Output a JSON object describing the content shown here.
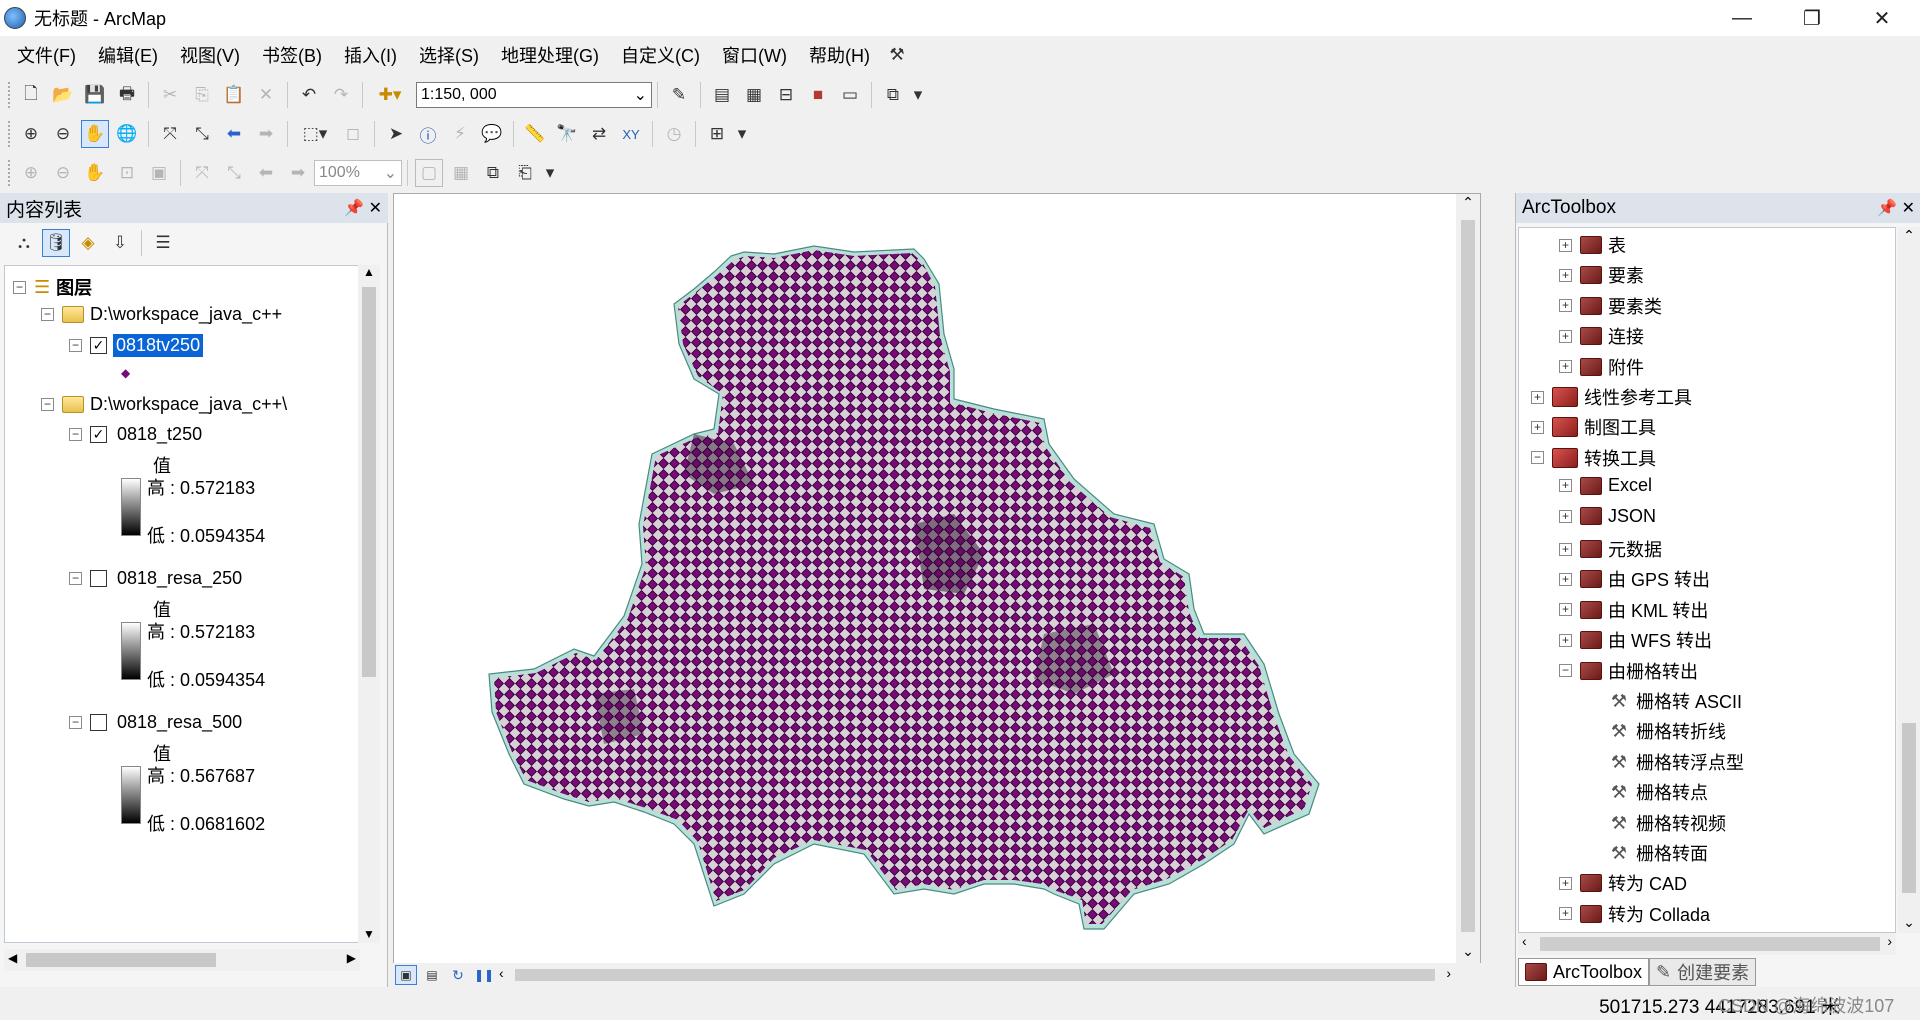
{
  "window": {
    "title": "无标题 - ArcMap",
    "minimize": "—",
    "restore": "❐",
    "close": "✕"
  },
  "menu": [
    "文件(F)",
    "编辑(E)",
    "视图(V)",
    "书签(B)",
    "插入(I)",
    "选择(S)",
    "地理处理(G)",
    "自定义(C)",
    "窗口(W)",
    "帮助(H)"
  ],
  "toolbar": {
    "scale": "1:150, 000",
    "zoom_pct": "100%"
  },
  "toc": {
    "title": "内容列表",
    "root": "图层",
    "groups": [
      {
        "path": "D:\\workspace_java_c++",
        "layers": [
          {
            "name": "0818tv250",
            "checked": true,
            "selected": true
          }
        ]
      },
      {
        "path": "D:\\workspace_java_c++\\",
        "layers": [
          {
            "name": "0818_t250",
            "checked": true,
            "value_label": "值",
            "high": "高 : 0.572183",
            "low": "低 : 0.0594354"
          },
          {
            "name": "0818_resa_250",
            "checked": false,
            "value_label": "值",
            "high": "高 : 0.572183",
            "low": "低 : 0.0594354"
          },
          {
            "name": "0818_resa_500",
            "checked": false,
            "value_label": "值",
            "high": "高 : 0.567687",
            "low": "低 : 0.0681602"
          }
        ]
      }
    ]
  },
  "arctoolbox": {
    "title": "ArcToolbox",
    "items": [
      {
        "label": "表",
        "level": 1,
        "kind": "toolset",
        "exp": "+"
      },
      {
        "label": "要素",
        "level": 1,
        "kind": "toolset",
        "exp": "+"
      },
      {
        "label": "要素类",
        "level": 1,
        "kind": "toolset",
        "exp": "+"
      },
      {
        "label": "连接",
        "level": 1,
        "kind": "toolset",
        "exp": "+"
      },
      {
        "label": "附件",
        "level": 1,
        "kind": "toolset",
        "exp": "+"
      },
      {
        "label": "线性参考工具",
        "level": 0,
        "kind": "toolbox",
        "exp": "+"
      },
      {
        "label": "制图工具",
        "level": 0,
        "kind": "toolbox",
        "exp": "+"
      },
      {
        "label": "转换工具",
        "level": 0,
        "kind": "toolbox",
        "exp": "−"
      },
      {
        "label": "Excel",
        "level": 1,
        "kind": "toolset",
        "exp": "+"
      },
      {
        "label": "JSON",
        "level": 1,
        "kind": "toolset",
        "exp": "+"
      },
      {
        "label": "元数据",
        "level": 1,
        "kind": "toolset",
        "exp": "+"
      },
      {
        "label": "由 GPS 转出",
        "level": 1,
        "kind": "toolset",
        "exp": "+"
      },
      {
        "label": "由 KML 转出",
        "level": 1,
        "kind": "toolset",
        "exp": "+"
      },
      {
        "label": "由 WFS 转出",
        "level": 1,
        "kind": "toolset",
        "exp": "+"
      },
      {
        "label": "由栅格转出",
        "level": 1,
        "kind": "toolset",
        "exp": "−"
      },
      {
        "label": "栅格转 ASCII",
        "level": 2,
        "kind": "tool",
        "exp": ""
      },
      {
        "label": "栅格转折线",
        "level": 2,
        "kind": "tool",
        "exp": ""
      },
      {
        "label": "栅格转浮点型",
        "level": 2,
        "kind": "tool",
        "exp": ""
      },
      {
        "label": "栅格转点",
        "level": 2,
        "kind": "tool",
        "exp": ""
      },
      {
        "label": "栅格转视频",
        "level": 2,
        "kind": "tool",
        "exp": ""
      },
      {
        "label": "栅格转面",
        "level": 2,
        "kind": "tool",
        "exp": ""
      },
      {
        "label": "转为 CAD",
        "level": 1,
        "kind": "toolset",
        "exp": "+"
      },
      {
        "label": "转为 Collada",
        "level": 1,
        "kind": "toolset",
        "exp": "+"
      }
    ],
    "tabs": [
      "ArcToolbox",
      "创建要素"
    ]
  },
  "status": {
    "coords": "501715.273  4417283.691 米",
    "watermark": "CSDN @海绵波波107"
  },
  "colors": {
    "point_fill": "#7a0a7a",
    "selection": "#0a64d6"
  }
}
